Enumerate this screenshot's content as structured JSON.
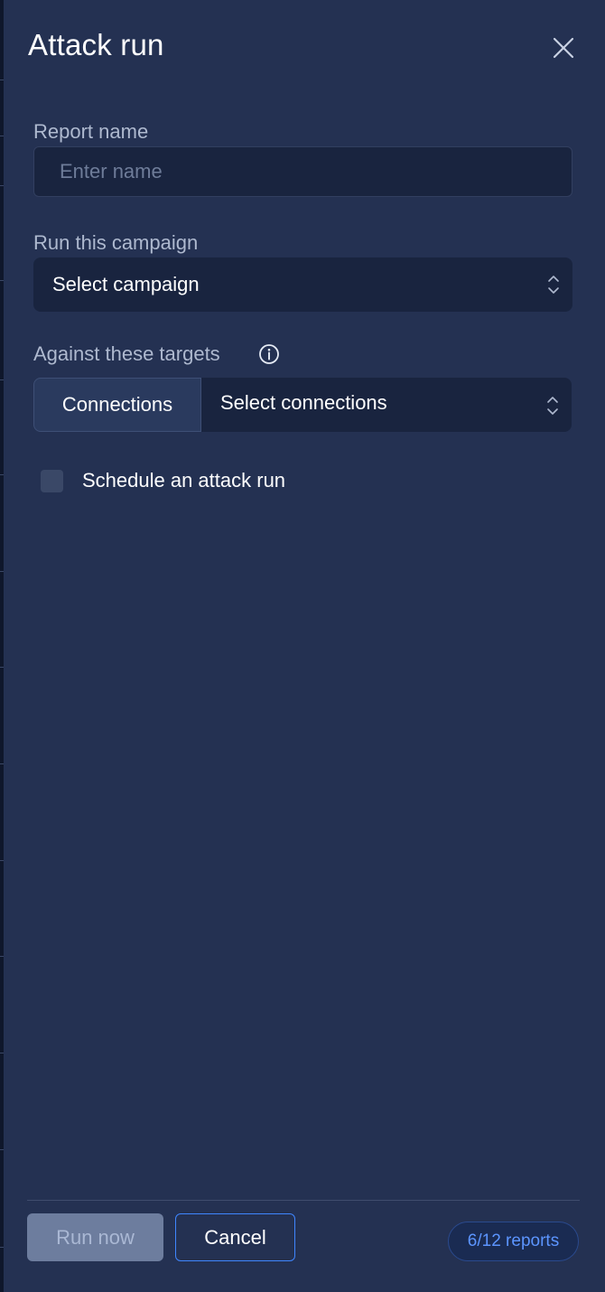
{
  "dialog": {
    "title": "Attack run",
    "close_icon": "close-icon"
  },
  "form": {
    "report_name": {
      "label": "Report name",
      "placeholder": "Enter name",
      "value": ""
    },
    "campaign": {
      "label": "Run this campaign",
      "selected": "Select campaign",
      "icon": "chevron-up-down-icon"
    },
    "targets": {
      "label": "Against these targets",
      "info_icon": "info-icon",
      "type_button": "Connections",
      "selected": "Select connections",
      "icon": "chevron-up-down-icon"
    },
    "schedule": {
      "label": "Schedule an attack run",
      "checked": false
    }
  },
  "footer": {
    "run_now": "Run now",
    "cancel": "Cancel",
    "reports_badge": "6/12 reports"
  },
  "colors": {
    "panel_bg": "#243152",
    "input_bg": "#19243f",
    "accent": "#3f86ff",
    "badge_text": "#5c95ff"
  }
}
